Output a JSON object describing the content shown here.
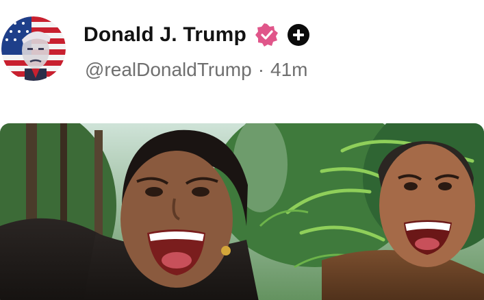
{
  "post": {
    "author": {
      "display_name": "Donald J. Trump",
      "handle": "@realDonaldTrump",
      "verified": true,
      "avatar_icon": "flag-portrait-avatar"
    },
    "separator": "·",
    "timestamp": "41m",
    "media": {
      "kind": "image",
      "scene": "jungle-cartoon"
    }
  },
  "colors": {
    "name_text": "#121212",
    "meta_text": "#6f6f6f",
    "verified_badge": "#e0568a",
    "follow_badge": "#0b0b0b"
  }
}
